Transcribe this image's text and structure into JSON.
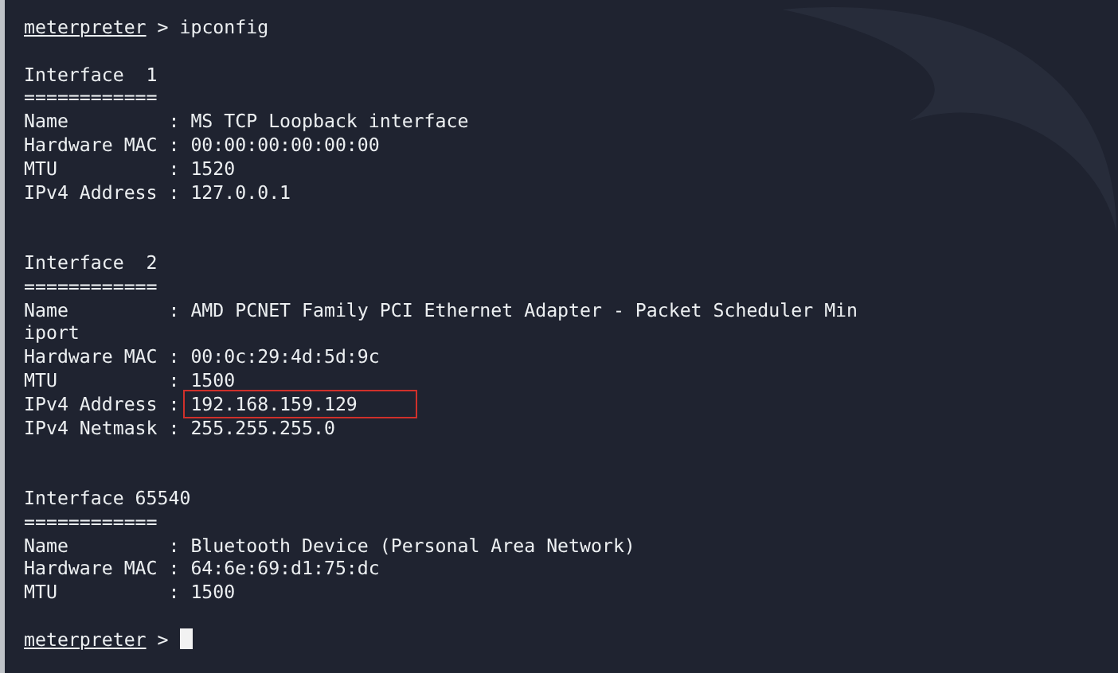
{
  "lines": [
    {
      "kind": "prompt",
      "prompt": "meterpreter",
      "symbol": ">",
      "command": "ipconfig",
      "cursor": false
    },
    {
      "kind": "blank"
    },
    {
      "kind": "text",
      "text": "Interface  1"
    },
    {
      "kind": "text",
      "text": "============"
    },
    {
      "kind": "field",
      "label": "Name",
      "separator": ":",
      "value": "MS TCP Loopback interface",
      "highlighted": false
    },
    {
      "kind": "field",
      "label": "Hardware MAC",
      "separator": ":",
      "value": "00:00:00:00:00:00",
      "highlighted": false
    },
    {
      "kind": "field",
      "label": "MTU",
      "separator": ":",
      "value": "1520",
      "highlighted": false
    },
    {
      "kind": "field",
      "label": "IPv4 Address",
      "separator": ":",
      "value": "127.0.0.1",
      "highlighted": false
    },
    {
      "kind": "blank"
    },
    {
      "kind": "blank"
    },
    {
      "kind": "text",
      "text": "Interface  2"
    },
    {
      "kind": "text",
      "text": "============"
    },
    {
      "kind": "field",
      "label": "Name",
      "separator": ":",
      "value": "AMD PCNET Family PCI Ethernet Adapter - Packet Scheduler Min",
      "highlighted": false
    },
    {
      "kind": "text",
      "text": "iport"
    },
    {
      "kind": "field",
      "label": "Hardware MAC",
      "separator": ":",
      "value": "00:0c:29:4d:5d:9c",
      "highlighted": false
    },
    {
      "kind": "field",
      "label": "MTU",
      "separator": ":",
      "value": "1500",
      "highlighted": false
    },
    {
      "kind": "field",
      "label": "IPv4 Address",
      "separator": ":",
      "value": "192.168.159.129",
      "highlighted": true
    },
    {
      "kind": "field",
      "label": "IPv4 Netmask",
      "separator": ":",
      "value": "255.255.255.0",
      "highlighted": false
    },
    {
      "kind": "blank"
    },
    {
      "kind": "blank"
    },
    {
      "kind": "text",
      "text": "Interface 65540"
    },
    {
      "kind": "text",
      "text": "============"
    },
    {
      "kind": "field",
      "label": "Name",
      "separator": ":",
      "value": "Bluetooth Device (Personal Area Network)",
      "highlighted": false
    },
    {
      "kind": "field",
      "label": "Hardware MAC",
      "separator": ":",
      "value": "64:6e:69:d1:75:dc",
      "highlighted": false
    },
    {
      "kind": "field",
      "label": "MTU",
      "separator": ":",
      "value": "1500",
      "highlighted": false
    },
    {
      "kind": "blank"
    },
    {
      "kind": "prompt",
      "prompt": "meterpreter",
      "symbol": ">",
      "cursor": true
    }
  ]
}
